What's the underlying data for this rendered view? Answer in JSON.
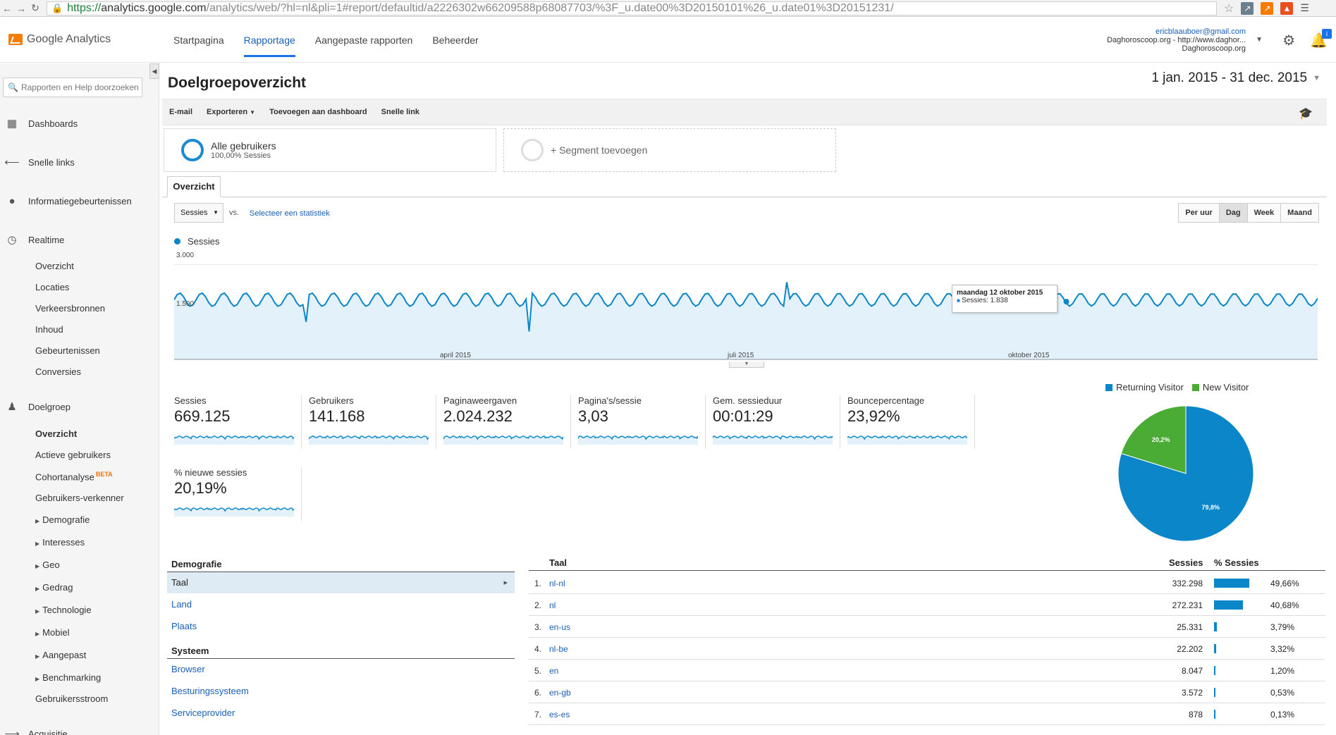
{
  "browser": {
    "url_https": "https://",
    "url_domain": "analytics.google.com",
    "url_path": "/analytics/web/?hl=nl&pli=1#report/defaultid/a2226302w66209588p68087703/%3F_u.date00%3D20150101%26_u.date01%3D20151231/"
  },
  "header": {
    "logo_text": "Google Analytics",
    "nav": [
      "Startpagina",
      "Rapportage",
      "Aangepaste rapporten",
      "Beheerder"
    ],
    "active_nav": "Rapportage",
    "account_email": "ericblaauboer@gmail.com",
    "account_property": "Daghoroscoop.org - http://www.daghor...",
    "account_view": "Daghoroscoop.org"
  },
  "sidebar": {
    "search_placeholder": "Rapporten en Help doorzoeken",
    "main": [
      {
        "label": "Dashboards",
        "icon": "grid-icon"
      },
      {
        "label": "Snelle links",
        "icon": "arrow-left-icon"
      },
      {
        "label": "Informatiegebeurtenissen",
        "icon": "lightbulb-icon"
      },
      {
        "label": "Realtime",
        "icon": "clock-icon"
      },
      {
        "label": "Doelgroep",
        "icon": "people-icon"
      },
      {
        "label": "Acquisitie",
        "icon": "arrow-right-icon"
      }
    ],
    "realtime_sub": [
      "Overzicht",
      "Locaties",
      "Verkeersbronnen",
      "Inhoud",
      "Gebeurtenissen",
      "Conversies"
    ],
    "audience_sub": [
      "Overzicht",
      "Actieve gebruikers",
      "Cohortanalyse",
      "Gebruikers-verkenner",
      "Demografie",
      "Interesses",
      "Geo",
      "Gedrag",
      "Technologie",
      "Mobiel",
      "Aangepast",
      "Benchmarking",
      "Gebruikersstroom"
    ],
    "beta_label": "BETA"
  },
  "main": {
    "title": "Doelgroepoverzicht",
    "date_range": "1 jan. 2015 - 31 dec. 2015",
    "toolbar": [
      "E-mail",
      "Exporteren",
      "Toevoegen aan dashboard",
      "Snelle link"
    ],
    "segment_title": "Alle gebruikers",
    "segment_sub": "100,00% Sessies",
    "segment_add": "+ Segment toevoegen",
    "tab": "Overzicht",
    "metric_select": "Sessies",
    "vs": "vs.",
    "select_stat": "Selecteer een statistiek",
    "periods": [
      "Per uur",
      "Dag",
      "Week",
      "Maand"
    ],
    "active_period": "Dag"
  },
  "chart_data": {
    "type": "line",
    "series": [
      {
        "name": "Sessies",
        "color": "#0a86c9"
      }
    ],
    "y_ticks": [
      "3.000",
      "1.500"
    ],
    "ylim": [
      0,
      3500
    ],
    "x_ticks": [
      "april 2015",
      "juli 2015",
      "oktober 2015"
    ],
    "approx_daily_range": [
      1600,
      2200
    ],
    "tooltip": {
      "date": "maandag 12 oktober 2015",
      "label": "Sessies: 1.838"
    }
  },
  "metrics": [
    {
      "label": "Sessies",
      "value": "669.125"
    },
    {
      "label": "Gebruikers",
      "value": "141.168"
    },
    {
      "label": "Paginaweergaven",
      "value": "2.024.232"
    },
    {
      "label": "Pagina's/sessie",
      "value": "3,03"
    },
    {
      "label": "Gem. sessieduur",
      "value": "00:01:29"
    },
    {
      "label": "Bouncepercentage",
      "value": "23,92%"
    },
    {
      "label": "% nieuwe sessies",
      "value": "20,19%"
    }
  ],
  "pie": {
    "legend": [
      {
        "name": "Returning Visitor",
        "color": "#0a86c9",
        "pct": 79.8,
        "label": "79,8%"
      },
      {
        "name": "New Visitor",
        "color": "#4aab35",
        "pct": 20.2,
        "label": "20,2%"
      }
    ]
  },
  "demografie": {
    "head": "Demografie",
    "items": [
      "Taal",
      "Land",
      "Plaats"
    ],
    "system_head": "Systeem",
    "system_items": [
      "Browser",
      "Besturingssysteem",
      "Serviceprovider"
    ]
  },
  "table": {
    "col_lang": "Taal",
    "col_sess": "Sessies",
    "col_pct": "% Sessies",
    "rows": [
      {
        "n": "1.",
        "lang": "nl-nl",
        "sess": "332.298",
        "pct": "49,66%",
        "v": 49.66
      },
      {
        "n": "2.",
        "lang": "nl",
        "sess": "272.231",
        "pct": "40,68%",
        "v": 40.68
      },
      {
        "n": "3.",
        "lang": "en-us",
        "sess": "25.331",
        "pct": "3,79%",
        "v": 3.79
      },
      {
        "n": "4.",
        "lang": "nl-be",
        "sess": "22.202",
        "pct": "3,32%",
        "v": 3.32
      },
      {
        "n": "5.",
        "lang": "en",
        "sess": "8.047",
        "pct": "1,20%",
        "v": 1.2
      },
      {
        "n": "6.",
        "lang": "en-gb",
        "sess": "3.572",
        "pct": "0,53%",
        "v": 0.53
      },
      {
        "n": "7.",
        "lang": "es-es",
        "sess": "878",
        "pct": "0,13%",
        "v": 0.13
      }
    ]
  }
}
